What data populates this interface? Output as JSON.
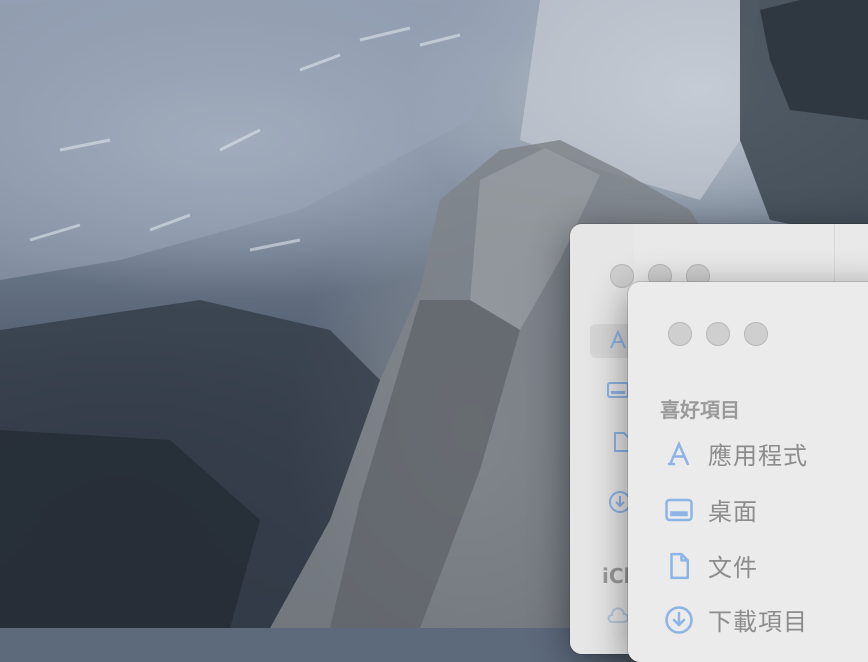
{
  "finder": {
    "sidebar": {
      "section_favorites": "喜好項目",
      "items": [
        {
          "label": "應用程式",
          "icon": "applications-icon"
        },
        {
          "label": "桌面",
          "icon": "desktop-icon"
        },
        {
          "label": "文件",
          "icon": "document-icon"
        },
        {
          "label": "下載項目",
          "icon": "downloads-icon"
        }
      ]
    },
    "back_window_section_partial": "iCl"
  },
  "colors": {
    "accent_icon": "#8db4e6",
    "window_bg": "#ebebeb",
    "traffic_light_inactive": "#cfcfcf"
  }
}
